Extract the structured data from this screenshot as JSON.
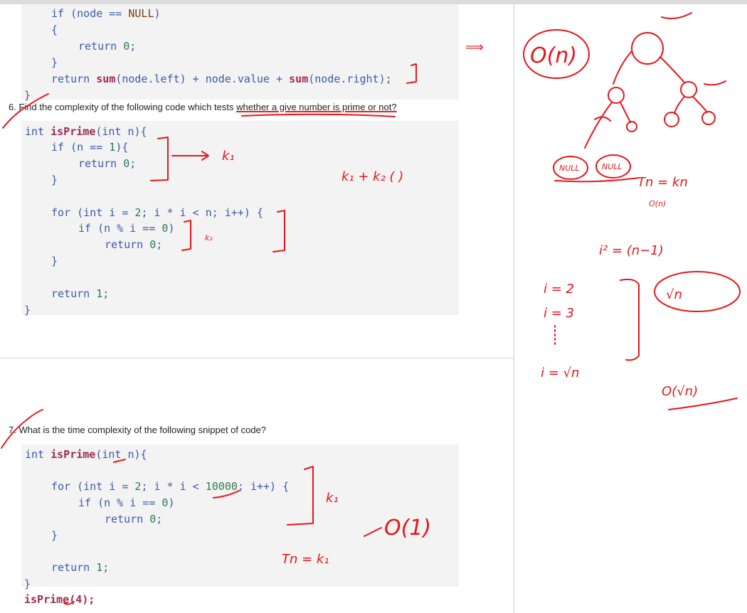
{
  "snippet_top": {
    "lines": [
      "if (node == NULL)",
      "{",
      "return 0;",
      "}",
      "return sum(node.left) + node.value + sum(node.right);",
      "}"
    ]
  },
  "q6": {
    "number": "6.",
    "text_before": "Find the complexity of the following code which tests ",
    "text_underlined": "whether a give number is prime or not?",
    "code": [
      "int isPrime(int n){",
      "if (n == 1){",
      "return 0;",
      "}",
      "for (int i = 2; i * i < n; i++) {",
      "if (n % i == 0)",
      "return 0;",
      "}",
      "return 1;",
      "}"
    ]
  },
  "q7": {
    "number": "7.",
    "text": "What is the time complexity of the following snippet of code?",
    "code": [
      "int isPrime(int n){",
      "for (int i = 2; i * i < 10000; i++) {",
      "if (n % i == 0)",
      "return 0;",
      "}",
      "return 1;",
      "}",
      "isPrime(4);"
    ]
  },
  "annotations": {
    "k1": "k₁",
    "k2": "k₂",
    "k1_plus_k2": "k₁ + k₂ (  )",
    "o_n": "O(n)",
    "null_left": "NULL",
    "null_right": "NULL",
    "tn_kn": "Tn = kn",
    "o_n_small": "O(n)",
    "i_sq": "i² = (n−1)",
    "i_eq_2": "i = 2",
    "i_eq_3": "i = 3",
    "i_eq_sqrt": "i = √n",
    "sqrt_n": "√n",
    "o_sqrt_n": "O(√n)",
    "tn_k1": "Tn = k₁",
    "o_1": "O(1)",
    "implies": "⟹"
  },
  "colors": {
    "ink": "#e8161a",
    "code_bg": "#f3f3f3",
    "keyword": "#3d5aa8",
    "function": "#9b2c50"
  }
}
